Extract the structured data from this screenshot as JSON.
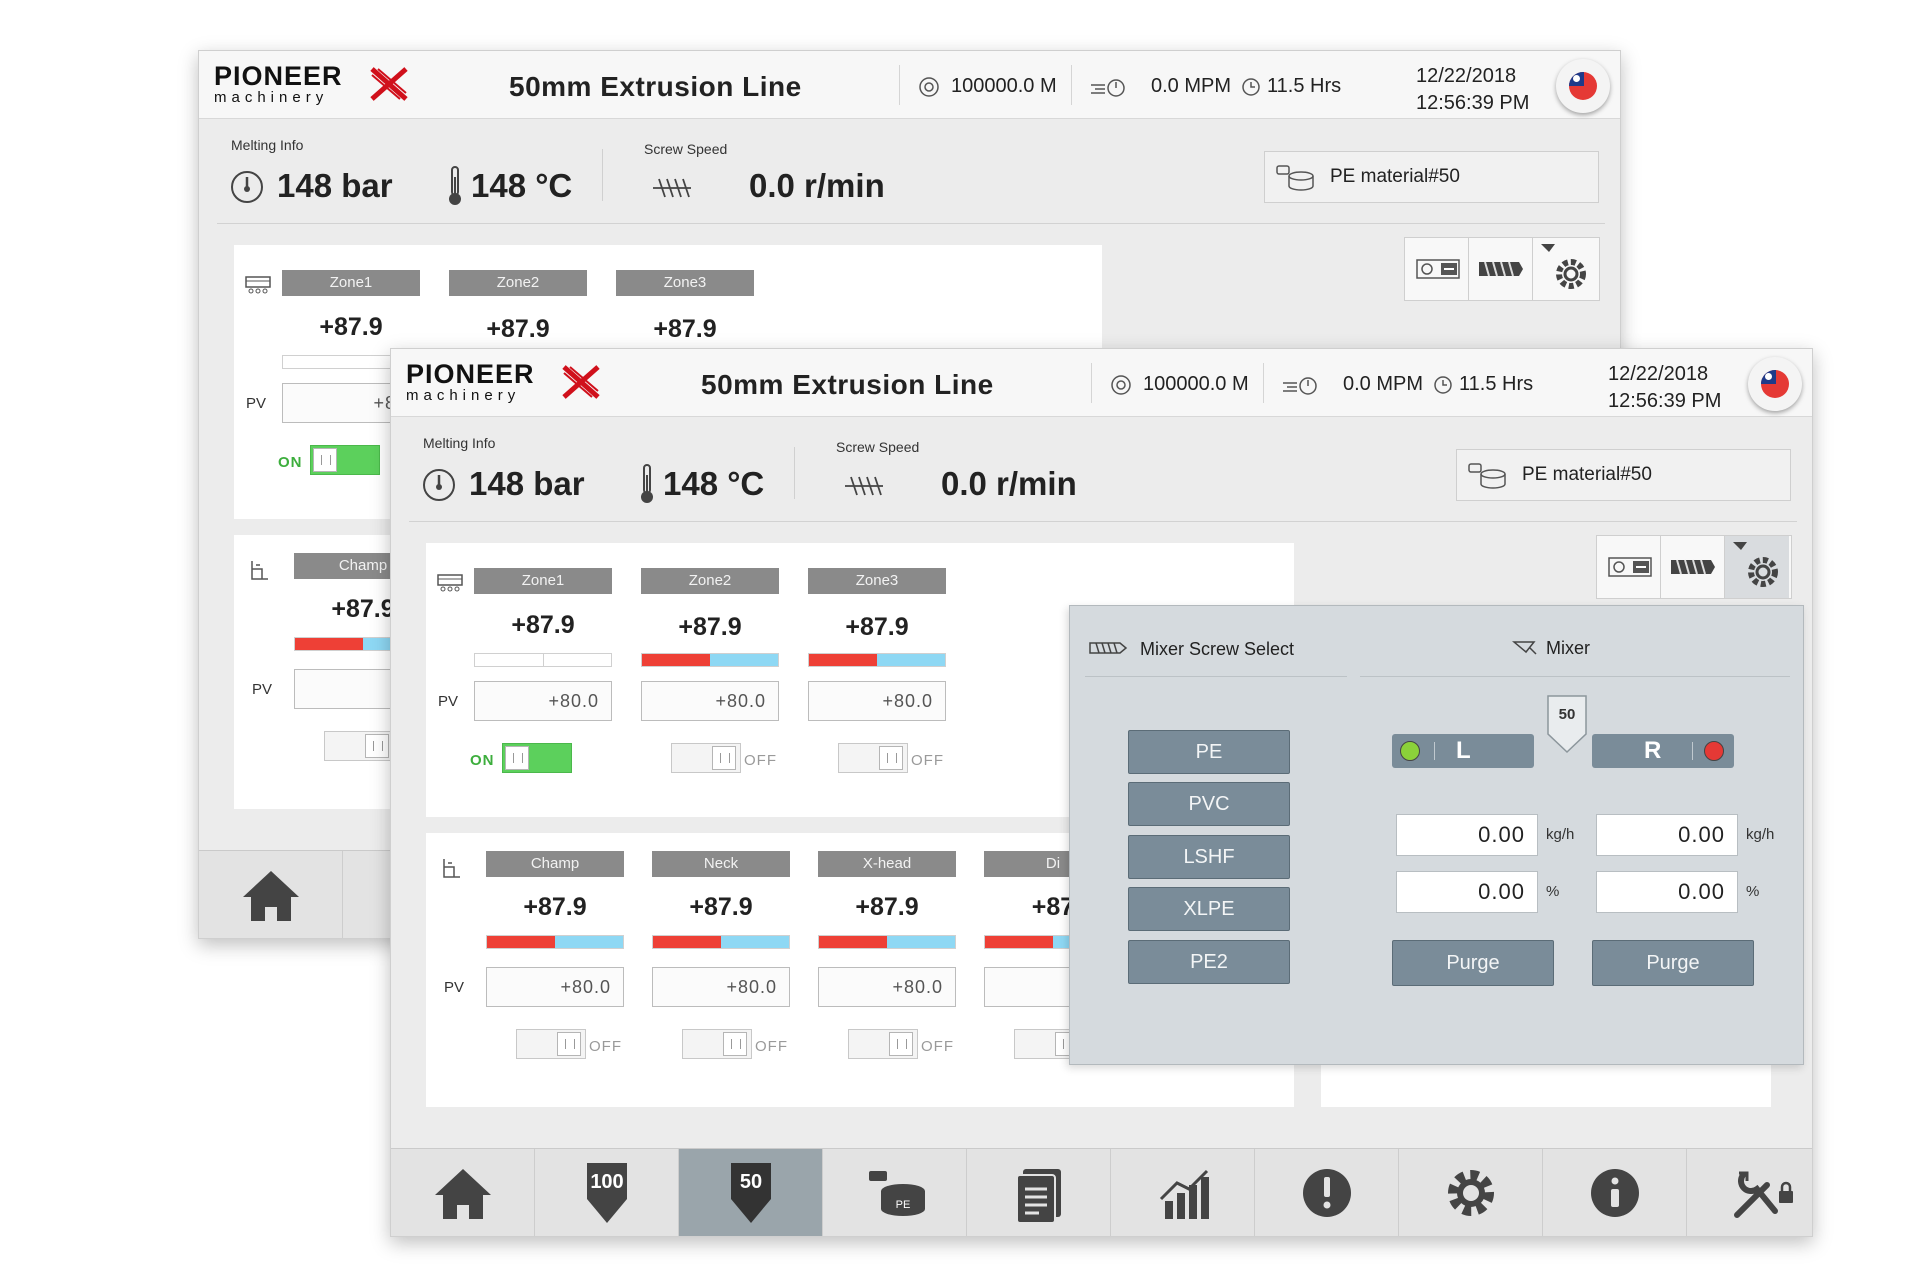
{
  "brand": {
    "name": "PIONEER",
    "sub": "machinery"
  },
  "header": {
    "title": "50mm  Extrusion Line",
    "length": "100000.0 M",
    "speed": "0.0 MPM",
    "hours": "11.5 Hrs",
    "date": "12/22/2018",
    "time": "12:56:39 PM"
  },
  "melting": {
    "label": "Melting Info",
    "pressure": "148 bar",
    "temperature": "148 °C"
  },
  "screw": {
    "label": "Screw Speed",
    "value": "0.0 r/min"
  },
  "material": "PE material#50",
  "zones": {
    "pv_label": "PV",
    "on_label": "ON",
    "off_label": "OFF",
    "row1": [
      {
        "name": "Zone1",
        "value": "+87.9",
        "pv": "+80.0",
        "state": "on",
        "fill_red_fraction": 0.0
      },
      {
        "name": "Zone2",
        "value": "+87.9",
        "pv": "+80.0",
        "state": "off",
        "fill_red_fraction": 0.5
      },
      {
        "name": "Zone3",
        "value": "+87.9",
        "pv": "+80.0",
        "state": "off",
        "fill_red_fraction": 0.5
      }
    ],
    "row2": [
      {
        "name": "Champ",
        "value": "+87.9",
        "pv": "+80.0",
        "state": "off"
      },
      {
        "name": "Neck",
        "value": "+87.9",
        "pv": "+80.0",
        "state": "off"
      },
      {
        "name": "X-head",
        "value": "+87.9",
        "pv": "+80.0",
        "state": "off"
      },
      {
        "name": "Di",
        "value": "+87",
        "pv": "",
        "state": "off"
      }
    ],
    "back_pv_partial": "+80",
    "back_value_partial": "+87.9",
    "back_champ_partial": "+87.9",
    "back_pv2_partial": "+8"
  },
  "mixer_panel": {
    "screw_select_title": "Mixer Screw Select",
    "mixer_title": "Mixer",
    "screw_options": [
      "PE",
      "PVC",
      "LSHF",
      "XLPE",
      "PE2"
    ],
    "hopper_badge": "50",
    "left": {
      "letter": "L",
      "indicator_color": "#8bd13a",
      "kgh": "0.00",
      "pct": "0.00"
    },
    "right": {
      "letter": "R",
      "indicator_color": "#e53935",
      "kgh": "0.00",
      "pct": "0.00"
    },
    "unit_kgh": "kg/h",
    "unit_pct": "%",
    "purge_label": "Purge"
  },
  "navbar": {
    "items": [
      {
        "icon": "home-icon"
      },
      {
        "icon": "hopper-100-icon",
        "badge": "100"
      },
      {
        "icon": "hopper-50-icon",
        "badge": "50",
        "active": true
      },
      {
        "icon": "material-pe-icon",
        "badge": "PE"
      },
      {
        "icon": "document-icon"
      },
      {
        "icon": "chart-icon"
      },
      {
        "icon": "alarm-icon"
      },
      {
        "icon": "settings-icon"
      },
      {
        "icon": "info-icon"
      },
      {
        "icon": "tools-lock-icon"
      }
    ]
  },
  "colors": {
    "accent": "#7a8c99",
    "active_nav": "#9aa5ab",
    "on_green": "#5cd05c",
    "heat_red": "#ee4036",
    "cool_blue": "#8ed8f4"
  }
}
